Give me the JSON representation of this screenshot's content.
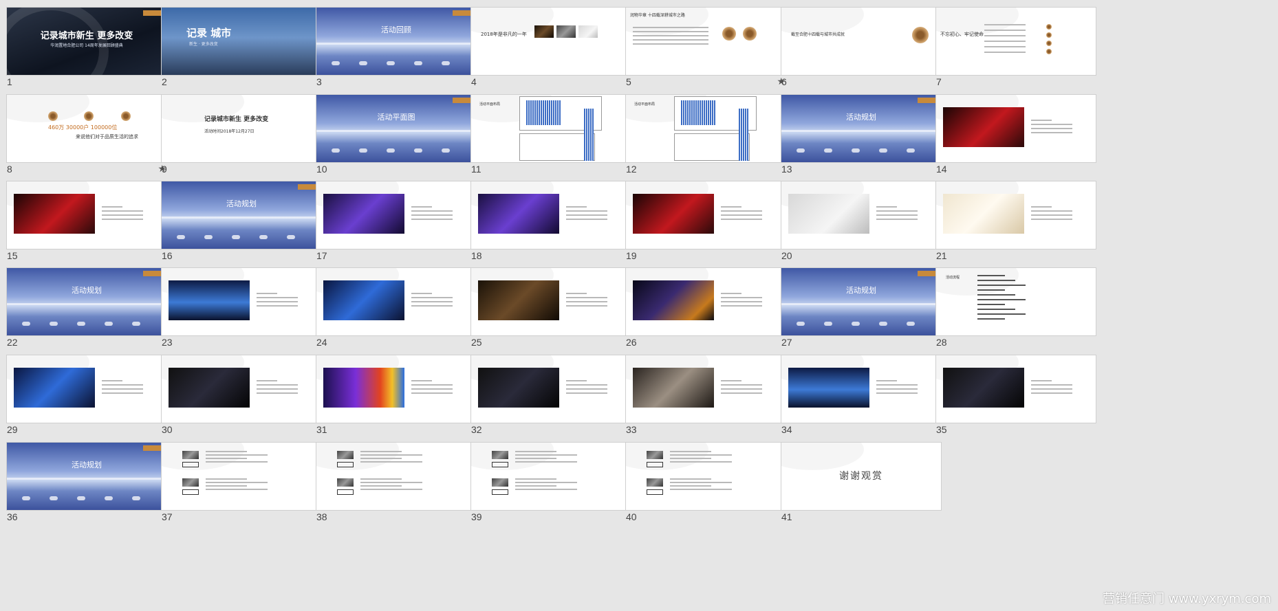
{
  "app": {
    "view": "slide-sorter",
    "total_slides": 41
  },
  "slides": [
    {
      "n": "1",
      "type": "cover-dark",
      "title": "记录城市新生 更多改变",
      "subtitle": "华润置地合肥公司 14周年发展回顾盛典",
      "starred": false
    },
    {
      "n": "2",
      "type": "city",
      "title": "记录 城市",
      "subtitle": "新生 · 更多改变",
      "starred": false
    },
    {
      "n": "3",
      "type": "sky",
      "title": "活动回顾",
      "starred": false
    },
    {
      "n": "4",
      "type": "white-photos",
      "title": "2018年是非凡的一年",
      "starred": false
    },
    {
      "n": "5",
      "type": "white-rings",
      "title": "润物华章 十四载深耕城市之路",
      "starred": true
    },
    {
      "n": "6",
      "type": "white-icon",
      "title": "截至合肥十四载与城市共成就",
      "starred": false
    },
    {
      "n": "7",
      "type": "white-tree",
      "title": "不忘初心、牢记使命",
      "starred": false
    },
    {
      "n": "8",
      "type": "white-stats",
      "title": "460万 30000户 100000位",
      "subtitle": "来说他们对于品质生活的追求",
      "starred": true
    },
    {
      "n": "9",
      "type": "white-text",
      "title": "记录城市新生 更多改变",
      "subtitle": "活动时间2018年12月27日",
      "starred": false
    },
    {
      "n": "10",
      "type": "sky",
      "title": "活动平面图",
      "starred": false
    },
    {
      "n": "11",
      "type": "floorplan",
      "title": "活动平面布局",
      "starred": false
    },
    {
      "n": "12",
      "type": "floorplan",
      "title": "活动平面布局",
      "starred": false
    },
    {
      "n": "13",
      "type": "sky",
      "title": "活动规划",
      "starred": false
    },
    {
      "n": "14",
      "type": "white-photo",
      "photo": "p-red",
      "starred": false
    },
    {
      "n": "15",
      "type": "white-photo",
      "photo": "p-red",
      "starred": false
    },
    {
      "n": "16",
      "type": "sky",
      "title": "活动规划",
      "starred": false
    },
    {
      "n": "17",
      "type": "white-photo",
      "photo": "p-purple",
      "starred": false
    },
    {
      "n": "18",
      "type": "white-photo",
      "photo": "p-purple",
      "starred": false
    },
    {
      "n": "19",
      "type": "white-photo",
      "photo": "p-red",
      "starred": false
    },
    {
      "n": "20",
      "type": "white-photo",
      "photo": "p-grey",
      "starred": false
    },
    {
      "n": "21",
      "type": "white-photo",
      "photo": "p-cream",
      "starred": false
    },
    {
      "n": "22",
      "type": "sky",
      "title": "活动规划",
      "starred": false
    },
    {
      "n": "23",
      "type": "white-photo",
      "photo": "p-stage",
      "starred": false
    },
    {
      "n": "24",
      "type": "white-photo",
      "photo": "p-blue",
      "starred": false
    },
    {
      "n": "25",
      "type": "white-photo",
      "photo": "p-warm",
      "starred": false
    },
    {
      "n": "26",
      "type": "white-photo",
      "photo": "p-night",
      "starred": false
    },
    {
      "n": "27",
      "type": "sky",
      "title": "活动规划",
      "starred": false
    },
    {
      "n": "28",
      "type": "white-list",
      "title": "活动流程",
      "starred": false
    },
    {
      "n": "29",
      "type": "white-photo",
      "photo": "p-blue",
      "starred": false
    },
    {
      "n": "30",
      "type": "white-photo",
      "photo": "p-dark",
      "starred": false
    },
    {
      "n": "31",
      "type": "white-photo",
      "photo": "p-colors",
      "starred": false
    },
    {
      "n": "32",
      "type": "white-photo",
      "photo": "p-dark",
      "starred": false
    },
    {
      "n": "33",
      "type": "white-photo",
      "photo": "p-brown",
      "starred": false
    },
    {
      "n": "34",
      "type": "white-photo",
      "photo": "p-stage",
      "starred": false
    },
    {
      "n": "35",
      "type": "white-photo",
      "photo": "p-dark",
      "starred": false
    },
    {
      "n": "36",
      "type": "sky",
      "title": "活动规划",
      "starred": false
    },
    {
      "n": "37",
      "type": "white-thumbs",
      "starred": false
    },
    {
      "n": "38",
      "type": "white-thumbs",
      "starred": false
    },
    {
      "n": "39",
      "type": "white-thumbs",
      "starred": false
    },
    {
      "n": "40",
      "type": "white-thumbs",
      "starred": false
    },
    {
      "n": "41",
      "type": "thanks",
      "title": "谢谢观赏",
      "starred": false
    }
  ],
  "star_glyph": "★",
  "watermark": "营销任意门 www.yxrym.com"
}
